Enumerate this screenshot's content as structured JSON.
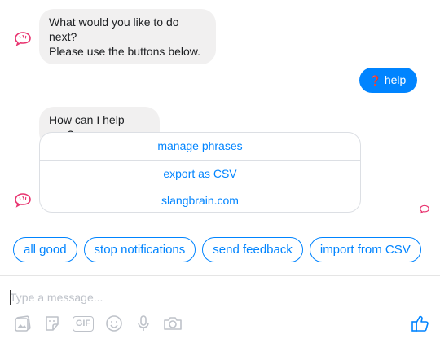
{
  "messages": {
    "bot_prompt_line1": "What would you like to do next?",
    "bot_prompt_line2": "Please use the buttons below.",
    "user_help_icon": "❓",
    "user_help_text": "help",
    "bot_help_question": "How can I help you?"
  },
  "card_buttons": [
    {
      "label": "manage phrases"
    },
    {
      "label": "export as CSV"
    },
    {
      "label": "slangbrain.com"
    }
  ],
  "quick_replies": [
    {
      "label": "all good"
    },
    {
      "label": "stop notifications"
    },
    {
      "label": "send feedback"
    },
    {
      "label": "import from CSV"
    }
  ],
  "composer": {
    "placeholder": "Type a message..."
  },
  "toolbar_icons": [
    "image-icon",
    "sticker-icon",
    "gif-icon",
    "emoji-icon",
    "microphone-icon",
    "camera-icon"
  ],
  "gif_label": "GIF",
  "colors": {
    "accent": "#0084ff",
    "bubble_gray": "#f1f0f0",
    "brain": "#e8336f",
    "toolbar_icon": "#bec2c9"
  }
}
